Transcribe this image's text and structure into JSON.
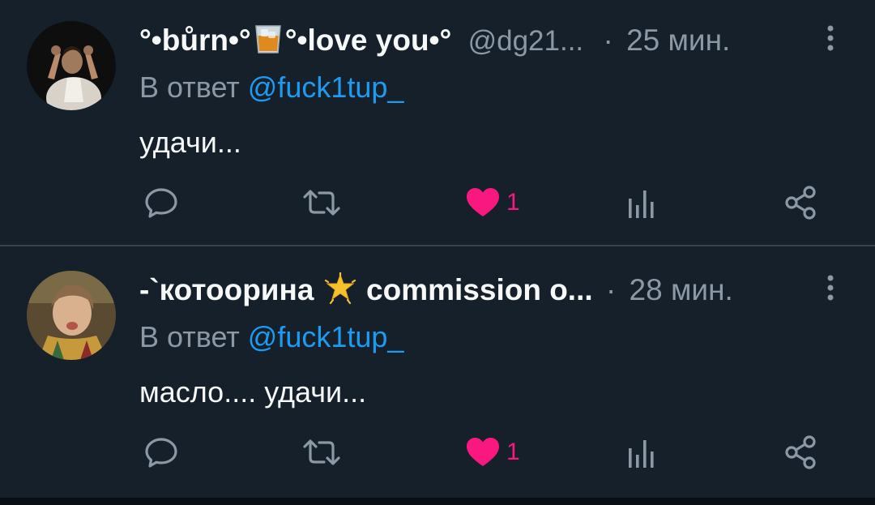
{
  "replies": [
    {
      "display_name_part1": "°•bůrn•°",
      "badge": "tumbler-glass-icon",
      "display_name_part2": "°•love you•°",
      "handle": "@dg21...",
      "separator": "·",
      "time": "25 мин.",
      "reply_to_label": "В ответ",
      "reply_to_handle": "@fuck1tup_",
      "text": "удачи...",
      "likes": "1",
      "liked": true
    },
    {
      "display_name_part1": "-`котоорина",
      "badge": "glowing-star-icon",
      "display_name_part2": "commission o...",
      "handle": "",
      "separator": "·",
      "time": "28 мин.",
      "reply_to_label": "В ответ",
      "reply_to_handle": "@fuck1tup_",
      "text": "масло.... удачи...",
      "likes": "1",
      "liked": true
    }
  ],
  "colors": {
    "background": "#15202b",
    "text": "#f7f9f9",
    "secondary": "#8b98a5",
    "link": "#1d9bf0",
    "like": "#f91880",
    "divider": "#38444d"
  }
}
